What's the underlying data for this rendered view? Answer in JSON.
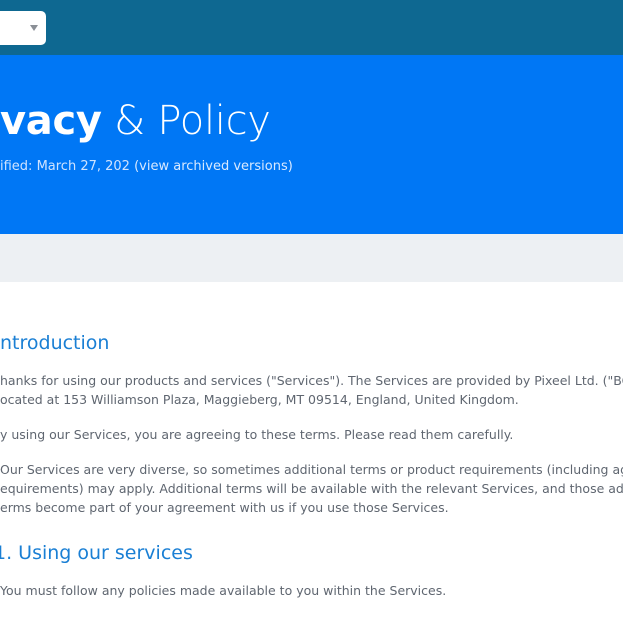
{
  "nav": {
    "select_value": ""
  },
  "hero": {
    "title_bold": "vacy",
    "title_rest": " & Policy",
    "modified_text": "ified: March 27, 202",
    "archived_link": "(view archived versions)"
  },
  "content": {
    "introduction": {
      "heading": "ntroduction",
      "paragraphs": [
        {
          "lines": [
            "hanks for using our products and services (\"Services\"). The Services are provided by Pixeel Ltd. (\"BCI\"),",
            "ocated at 153 Williamson Plaza, Maggieberg, MT 09514, England, United Kingdom."
          ]
        },
        {
          "lines": [
            "y using our Services, you are agreeing to these terms. Please read them carefully."
          ]
        },
        {
          "lines": [
            "Our Services are very diverse, so sometimes additional terms or product requirements (including age",
            "equirements) may apply. Additional terms will be available with the relevant Services, and those additional",
            "erms become part of your agreement with us if you use those Services."
          ]
        }
      ]
    },
    "using_services": {
      "heading": "1. Using our services",
      "paragraphs": [
        {
          "lines": [
            "You must follow any policies made available to you within the Services."
          ]
        }
      ]
    }
  }
}
